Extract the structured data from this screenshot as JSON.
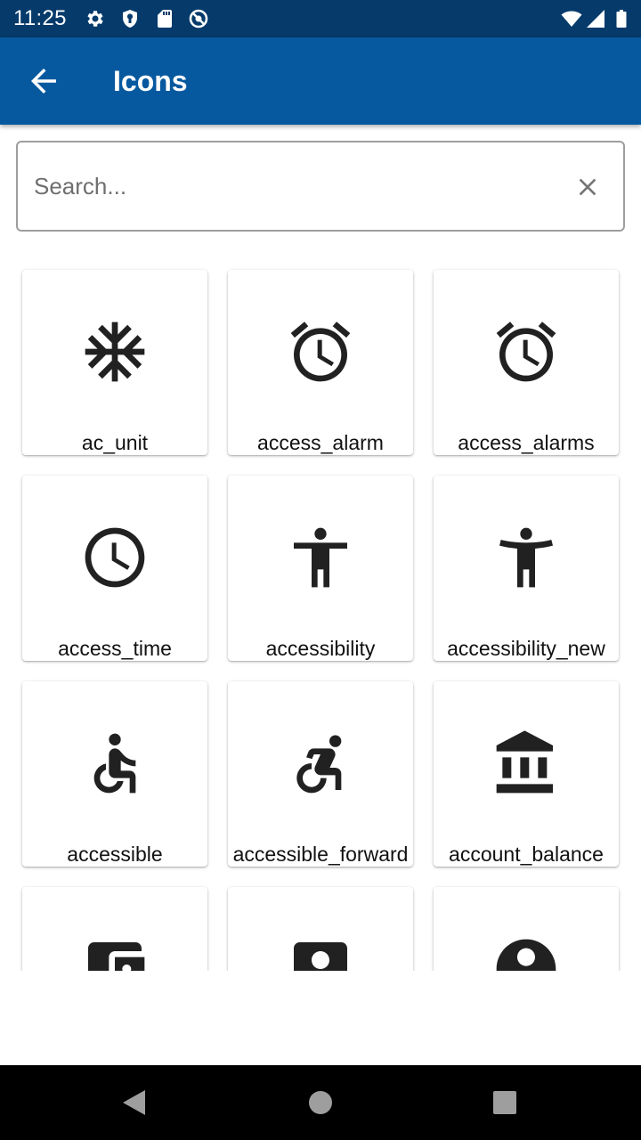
{
  "status_bar": {
    "time": "11:25",
    "left_icons": [
      "settings-icon",
      "shield-icon",
      "sd-card-icon",
      "no-sync-icon"
    ],
    "right_icons": [
      "wifi-icon",
      "cell-signal-icon",
      "battery-icon"
    ]
  },
  "app_bar": {
    "title": "Icons",
    "back_icon": "arrow-back-icon",
    "color": "#06599f"
  },
  "search": {
    "placeholder": "Search...",
    "value": "",
    "clear_icon": "close-icon"
  },
  "icons": [
    {
      "label": "ac_unit",
      "icon": "ac-unit-icon"
    },
    {
      "label": "access_alarm",
      "icon": "alarm-icon"
    },
    {
      "label": "access_alarms",
      "icon": "alarm-icon"
    },
    {
      "label": "access_time",
      "icon": "clock-icon"
    },
    {
      "label": "accessibility",
      "icon": "accessibility-icon"
    },
    {
      "label": "accessibility_new",
      "icon": "accessibility-new-icon"
    },
    {
      "label": "accessible",
      "icon": "wheelchair-icon"
    },
    {
      "label": "accessible_forward",
      "icon": "wheelchair-forward-icon"
    },
    {
      "label": "account_balance",
      "icon": "bank-icon"
    },
    {
      "label": "",
      "icon": "wallet-icon"
    },
    {
      "label": "",
      "icon": "account-box-icon"
    },
    {
      "label": "",
      "icon": "account-circle-icon"
    }
  ],
  "nav_bar": {
    "buttons": [
      "back-triangle-icon",
      "home-circle-icon",
      "recents-square-icon"
    ]
  }
}
